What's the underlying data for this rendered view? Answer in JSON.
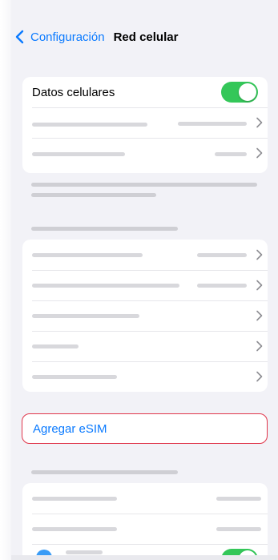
{
  "nav": {
    "back_label": "Configuración",
    "title": "Red celular",
    "back_icon": "chevron-left-icon"
  },
  "cellular": {
    "label": "Datos celulares",
    "toggle_on": true
  },
  "esim": {
    "label": "Agregar eSIM"
  },
  "colors": {
    "accent": "#0a7aff",
    "toggle_on": "#34c759",
    "highlight_border": "#e0354a",
    "background": "#f2f2f7"
  }
}
